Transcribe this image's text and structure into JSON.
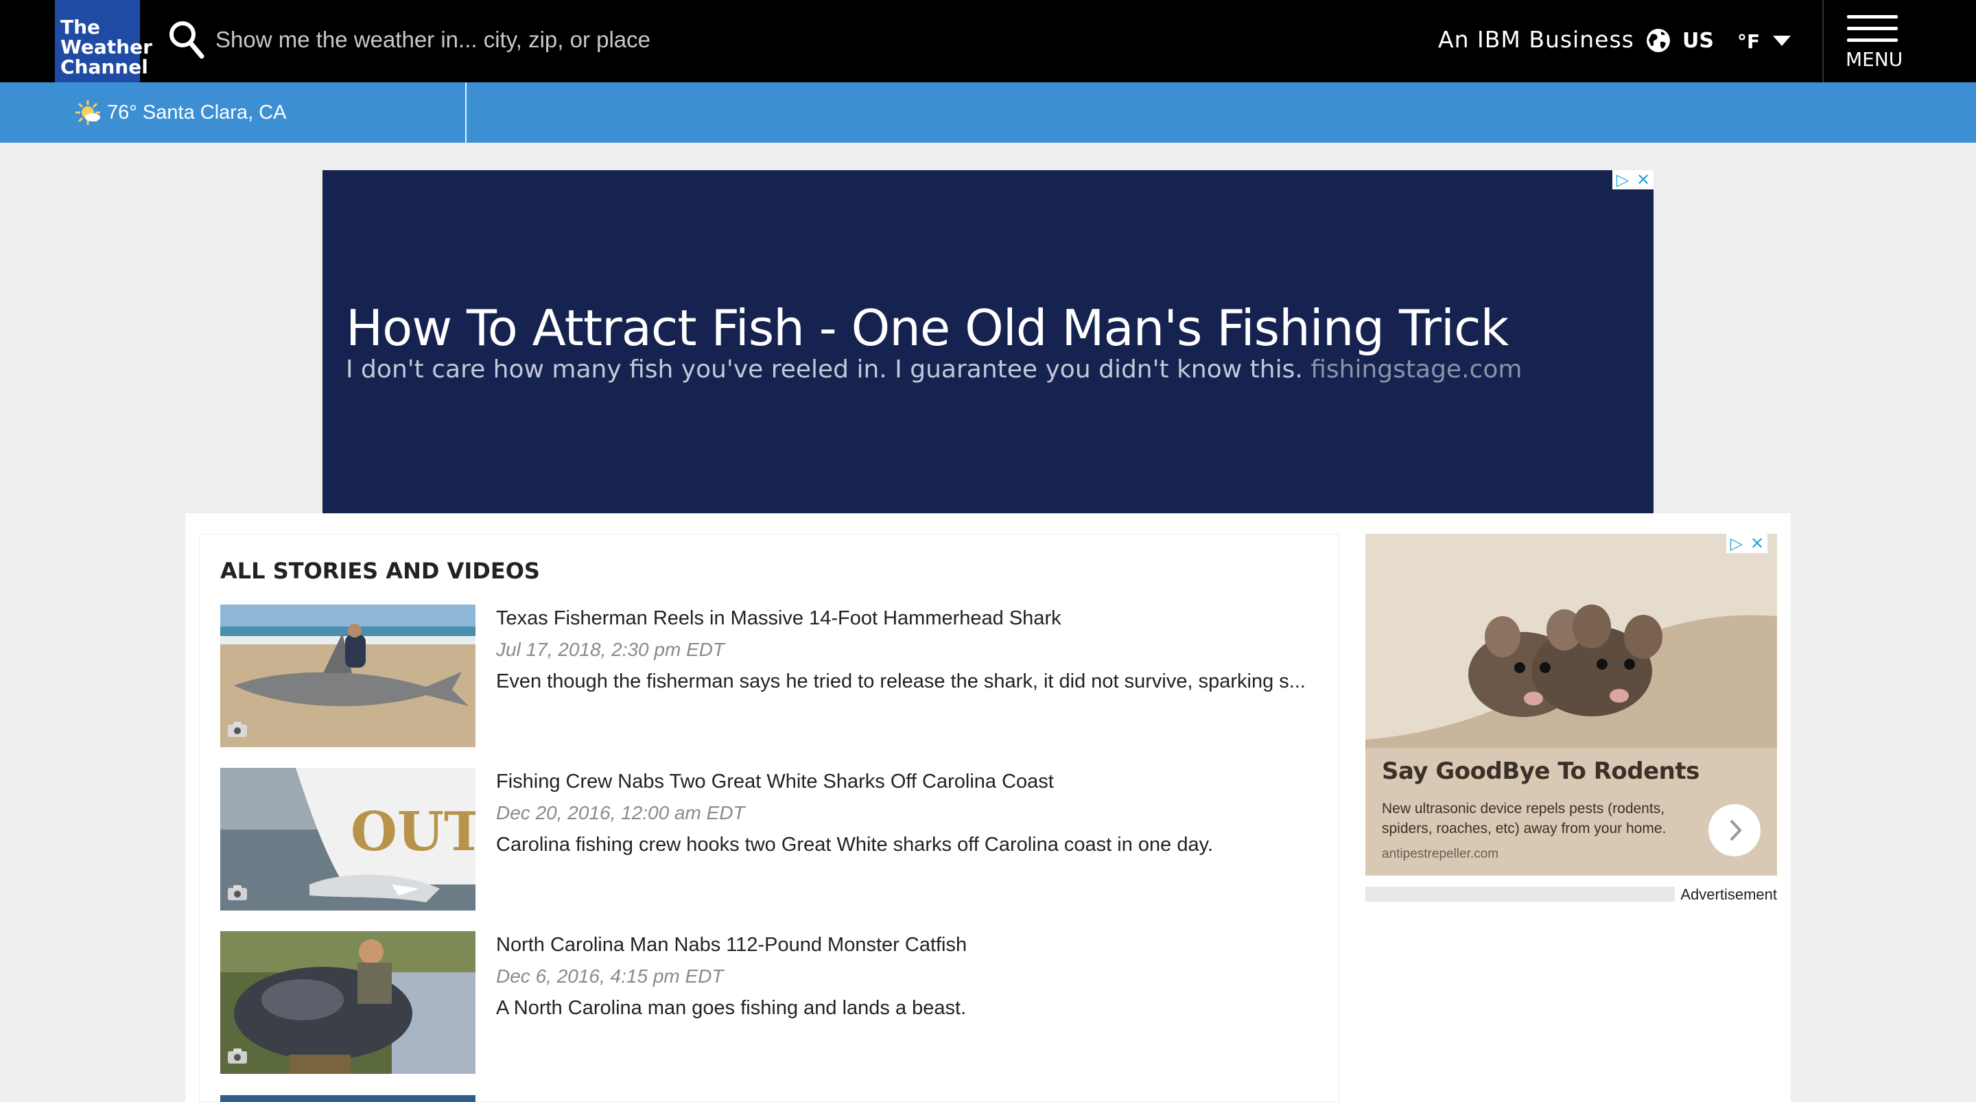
{
  "header": {
    "logo_lines": [
      "The",
      "Weather",
      "Channel"
    ],
    "search_placeholder": "Show me the weather in... city, zip, or place",
    "ibm_text": "An IBM Business",
    "region": "US",
    "unit": "°F",
    "menu_label": "MENU"
  },
  "location_bar": {
    "temperature": "76°",
    "city": "Santa Clara, CA"
  },
  "banner_ad": {
    "headline": "How To Attract Fish - One Old Man's Fishing Trick",
    "body": "I don't care how many fish you've reeled in. I guarantee you didn't know this.",
    "site": "fishingstage.com"
  },
  "stories": {
    "heading": "ALL STORIES AND VIDEOS",
    "items": [
      {
        "title": "Texas Fisherman Reels in Massive 14-Foot Hammerhead Shark",
        "date": "Jul 17, 2018, 2:30 pm EDT",
        "description": "Even though the fisherman says he tried to release the shark, it did not survive, sparking s..."
      },
      {
        "title": "Fishing Crew Nabs Two Great White Sharks Off Carolina Coast",
        "date": "Dec 20, 2016, 12:00 am EDT",
        "description": "Carolina fishing crew hooks two Great White sharks off Carolina coast in one day."
      },
      {
        "title": "North Carolina Man Nabs 112-Pound Monster Catfish",
        "date": "Dec 6, 2016, 4:15 pm EDT",
        "description": "A North Carolina man goes fishing and lands a beast."
      }
    ]
  },
  "side_ad": {
    "title": "Say GoodBye To Rodents",
    "description": "New ultrasonic device repels pests (rodents, spiders, roaches, etc) away from your home.",
    "site": "antipestrepeller.com",
    "label": "Advertisement"
  },
  "colors": {
    "top_bar": "#000000",
    "logo_bg": "#1f4ba4",
    "location_bar": "#3d8fd4",
    "banner_bg": "#16224f"
  }
}
